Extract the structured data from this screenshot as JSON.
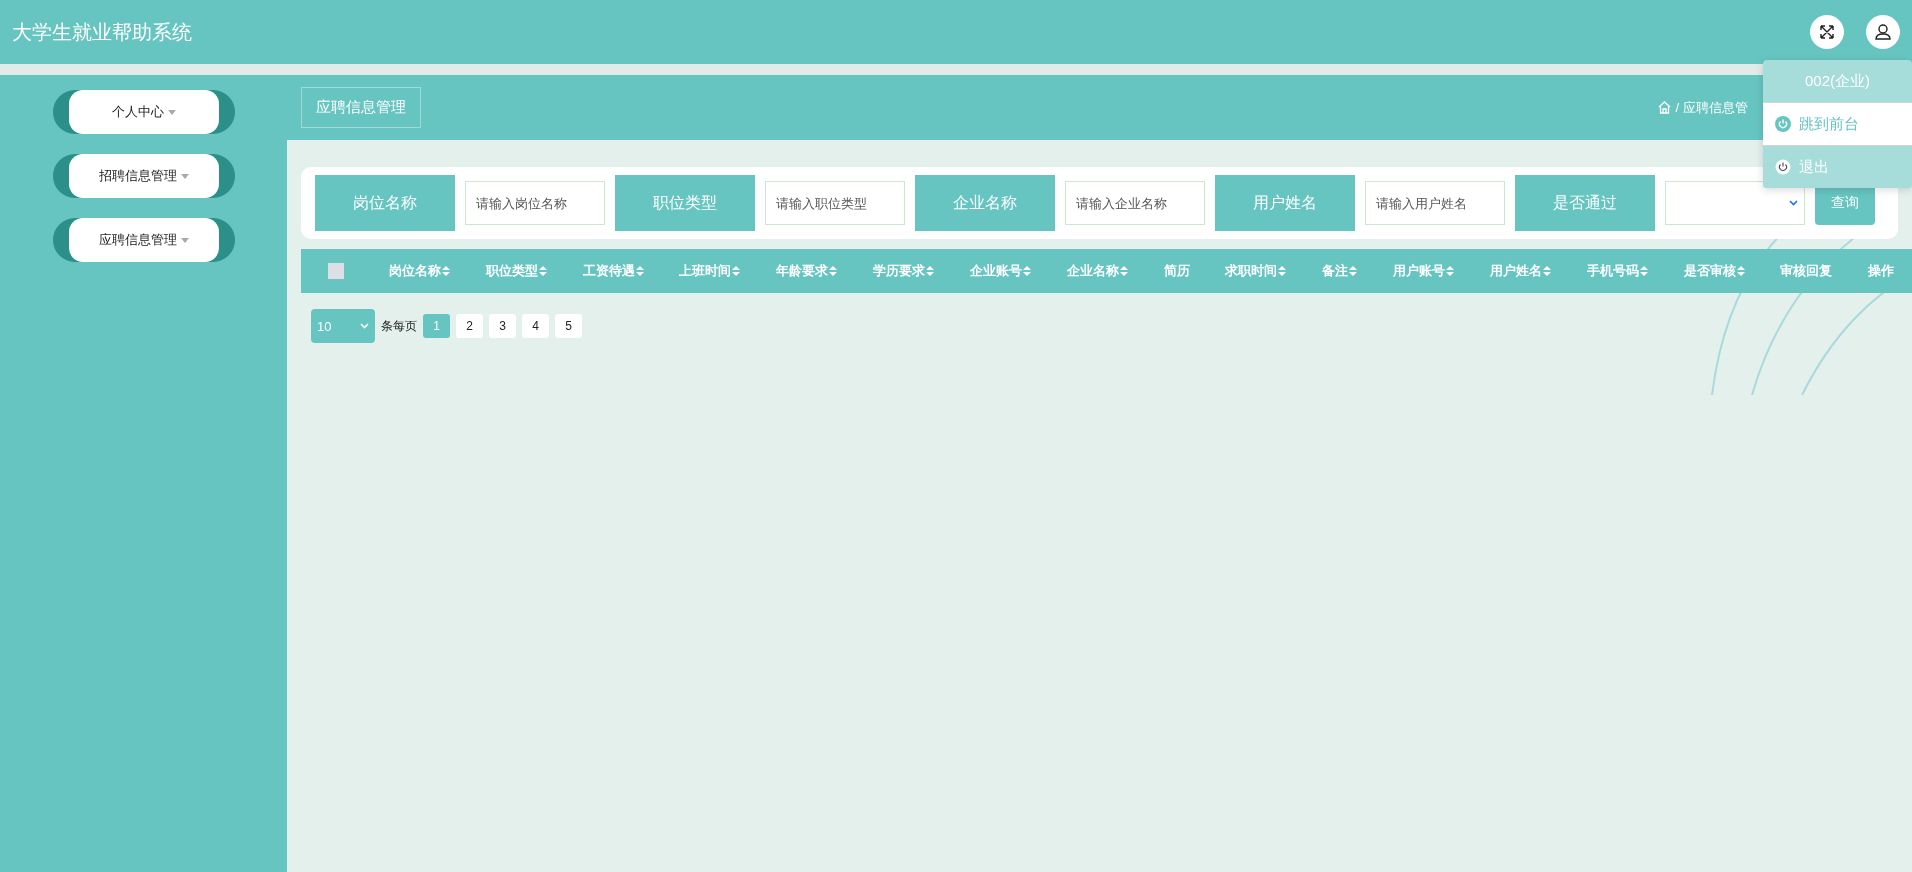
{
  "header": {
    "title": "大学生就业帮助系统"
  },
  "sidebar": {
    "items": [
      {
        "label": "个人中心"
      },
      {
        "label": "招聘信息管理"
      },
      {
        "label": "应聘信息管理"
      }
    ]
  },
  "page_tab": {
    "label": "应聘信息管理"
  },
  "breadcrumb": {
    "separator": "/",
    "current": "应聘信息管"
  },
  "user_menu": {
    "user": "002(企业)",
    "items": [
      {
        "label": "跳到前台",
        "selected": false
      },
      {
        "label": "退出",
        "selected": true
      }
    ]
  },
  "search": {
    "fields": [
      {
        "kind": "input",
        "label": "岗位名称",
        "placeholder": "请输入岗位名称"
      },
      {
        "kind": "input",
        "label": "职位类型",
        "placeholder": "请输入职位类型"
      },
      {
        "kind": "input",
        "label": "企业名称",
        "placeholder": "请输入企业名称"
      },
      {
        "kind": "input",
        "label": "用户姓名",
        "placeholder": "请输入用户姓名"
      },
      {
        "kind": "select",
        "label": "是否通过"
      }
    ],
    "button": "查询"
  },
  "table": {
    "select_all": {
      "checked": false
    },
    "columns": [
      {
        "label": "岗位名称",
        "sortable": true
      },
      {
        "label": "职位类型",
        "sortable": true
      },
      {
        "label": "工资待遇",
        "sortable": true
      },
      {
        "label": "上班时间",
        "sortable": true
      },
      {
        "label": "年龄要求",
        "sortable": true
      },
      {
        "label": "学历要求",
        "sortable": true
      },
      {
        "label": "企业账号",
        "sortable": true
      },
      {
        "label": "企业名称",
        "sortable": true
      },
      {
        "label": "简历",
        "sortable": false
      },
      {
        "label": "求职时间",
        "sortable": true
      },
      {
        "label": "备注",
        "sortable": true
      },
      {
        "label": "用户账号",
        "sortable": true
      },
      {
        "label": "用户姓名",
        "sortable": true
      },
      {
        "label": "手机号码",
        "sortable": true
      },
      {
        "label": "是否审核",
        "sortable": true
      },
      {
        "label": "审核回复",
        "sortable": false
      },
      {
        "label": "操作",
        "sortable": false
      }
    ]
  },
  "pagination": {
    "page_size": "10",
    "page_size_label": "条每页",
    "pages": [
      {
        "label": "1",
        "selected": true
      },
      {
        "label": "2",
        "selected": false
      },
      {
        "label": "3",
        "selected": false
      },
      {
        "label": "4",
        "selected": false
      },
      {
        "label": "5",
        "selected": false
      }
    ]
  }
}
